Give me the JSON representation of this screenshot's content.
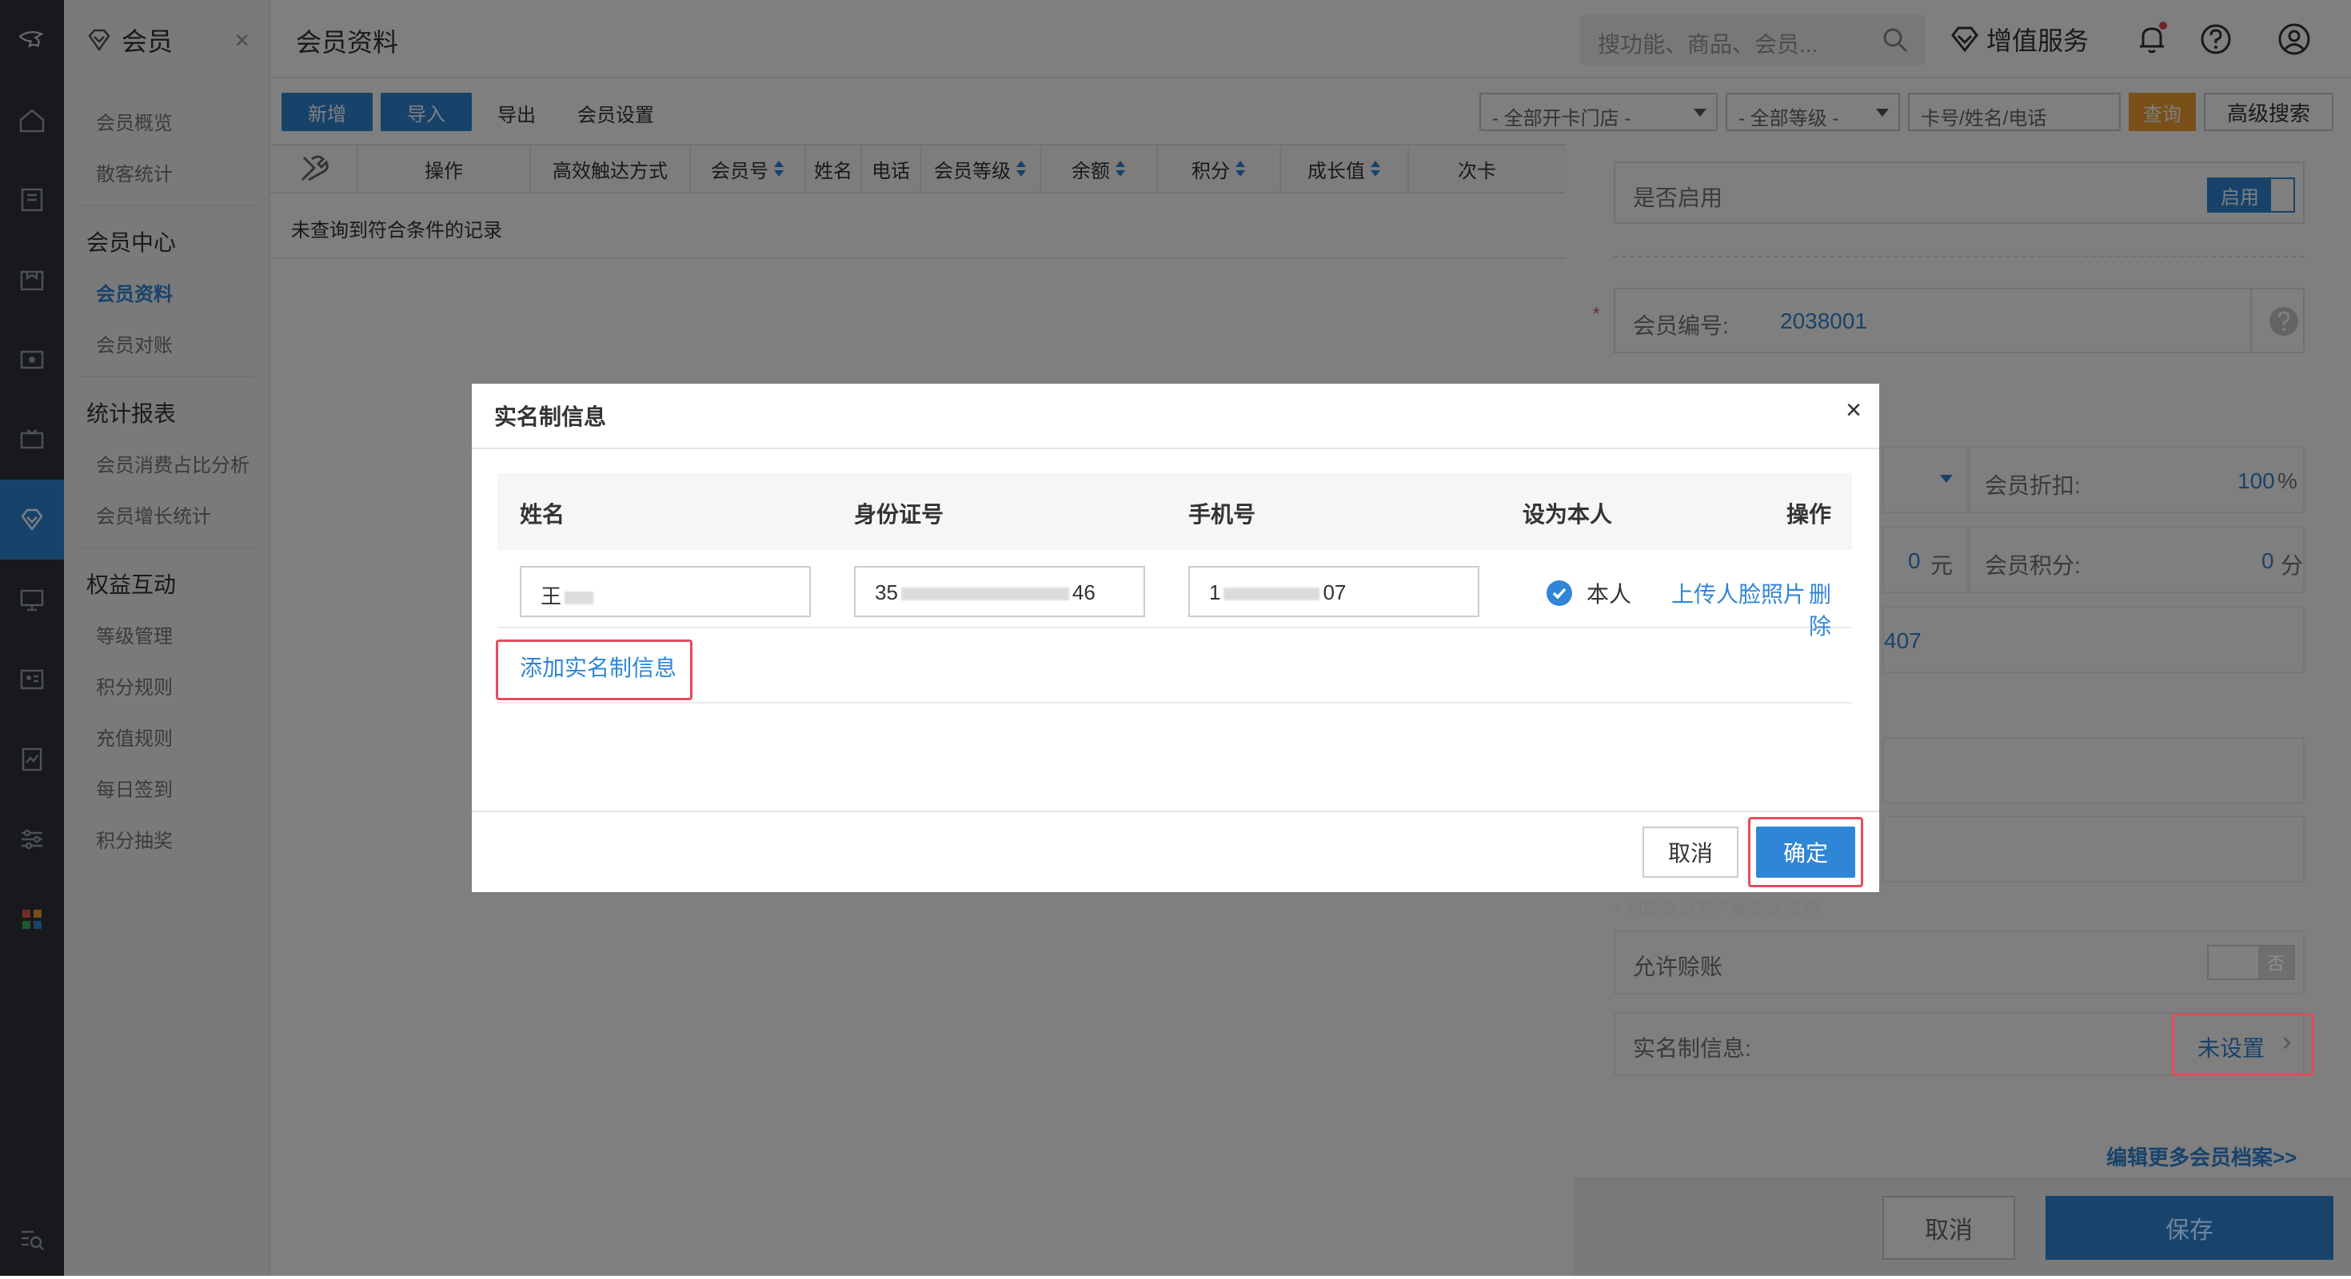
{
  "rail": {
    "logo": "子"
  },
  "menu": {
    "title": "会员",
    "items_top": [
      "会员概览",
      "散客统计"
    ],
    "group1": "会员中心",
    "group1_items": [
      "会员资料",
      "会员对账"
    ],
    "group2": "统计报表",
    "group2_items": [
      "会员消费占比分析",
      "会员增长统计"
    ],
    "group3": "权益互动",
    "group3_items": [
      "等级管理",
      "积分规则",
      "充值规则",
      "每日签到",
      "积分抽奖"
    ]
  },
  "header": {
    "page_title": "会员资料",
    "search_placeholder": "搜功能、商品、会员...",
    "value_added": "增值服务"
  },
  "toolbar": {
    "add": "新增",
    "import": "导入",
    "export": "导出",
    "settings": "会员设置",
    "store_filter": "- 全部开卡门店 -",
    "level_filter": "- 全部等级 -",
    "keyword_placeholder": "卡号/姓名/电话",
    "query": "查询",
    "advanced": "高级搜索"
  },
  "table": {
    "columns": [
      "操作",
      "高效触达方式",
      "会员号",
      "姓名",
      "电话",
      "会员等级",
      "余额",
      "积分",
      "成长值",
      "次卡"
    ],
    "empty_text": "未查询到符合条件的记录"
  },
  "side_form": {
    "enabled_label": "是否启用",
    "enabled_toggle": "启用",
    "member_no_label": "会员编号:",
    "member_no_value": "2038001",
    "discount_label": "会员折扣:",
    "discount_value": "100",
    "discount_unit": "%",
    "balance_value": "0",
    "balance_unit": "元",
    "points_label": "会员积分:",
    "points_value": "0",
    "points_unit": "分",
    "partial_value": "407",
    "expire_note": "* 到期会员客户端无法使用",
    "credit_label": "允许赊账",
    "credit_toggle": "否",
    "realname_label": "实名制信息:",
    "realname_value": "未设置",
    "more_link": "编辑更多会员档案>>",
    "cancel": "取消",
    "save": "保存"
  },
  "modal": {
    "title": "实名制信息",
    "close": "×",
    "columns": [
      "姓名",
      "身份证号",
      "手机号",
      "设为本人",
      "操作"
    ],
    "row": {
      "name_prefix": "王",
      "id_prefix": "35",
      "id_suffix": "46",
      "phone_prefix": "1",
      "phone_suffix": "07",
      "self_label": "本人",
      "upload_link": "上传人脸照片",
      "delete_link": "删除"
    },
    "add_link": "添加实名制信息",
    "cancel": "取消",
    "ok": "确定"
  },
  "colors": {
    "primary": "#2f86d6",
    "highlight": "#e64b5a",
    "orange": "#f0a030"
  }
}
